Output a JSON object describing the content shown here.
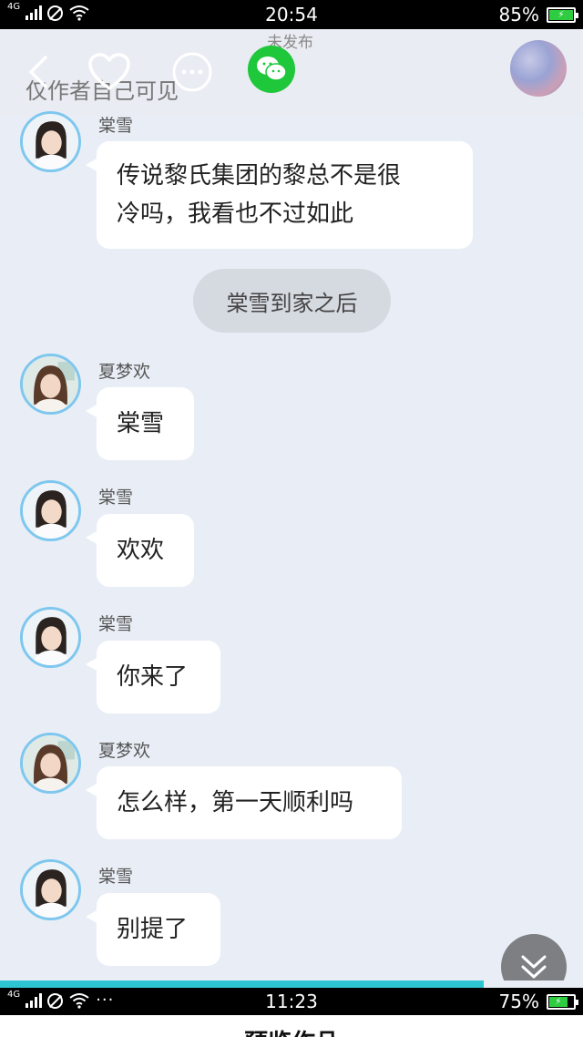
{
  "status_top": {
    "network": "4G",
    "time": "20:54",
    "battery": "85%"
  },
  "header": {
    "unpublished_label": "未发布",
    "visibility_label": "仅作者自己可见",
    "icons": [
      "back-icon",
      "heart-icon",
      "more-icon",
      "wechat-icon"
    ]
  },
  "chat": {
    "messages": [
      {
        "type": "message",
        "sender": "棠雪",
        "text_lines": [
          "传说黎氏集团的黎总不是很",
          "冷吗，我看也不过如此"
        ]
      },
      {
        "type": "narration",
        "text": "棠雪到家之后"
      },
      {
        "type": "message",
        "sender": "夏梦欢",
        "text": "棠雪"
      },
      {
        "type": "message",
        "sender": "棠雪",
        "text": "欢欢"
      },
      {
        "type": "message",
        "sender": "棠雪",
        "text": "你来了"
      },
      {
        "type": "message",
        "sender": "夏梦欢",
        "text": "怎么样，第一天顺利吗"
      },
      {
        "type": "message",
        "sender": "棠雪",
        "text": "别提了"
      }
    ]
  },
  "progress": {
    "fraction": 0.83,
    "color": "#2ec5d3"
  },
  "status_bottom": {
    "network": "4G",
    "more": "···",
    "time": "11:23",
    "battery": "75%"
  },
  "bottom_title": "预览作品",
  "colors": {
    "background": "#e9eef6",
    "bubble": "#ffffff",
    "avatar_ring": "#7ec7ee",
    "wechat": "#1fc73b",
    "narration": "#d5d9e0"
  }
}
